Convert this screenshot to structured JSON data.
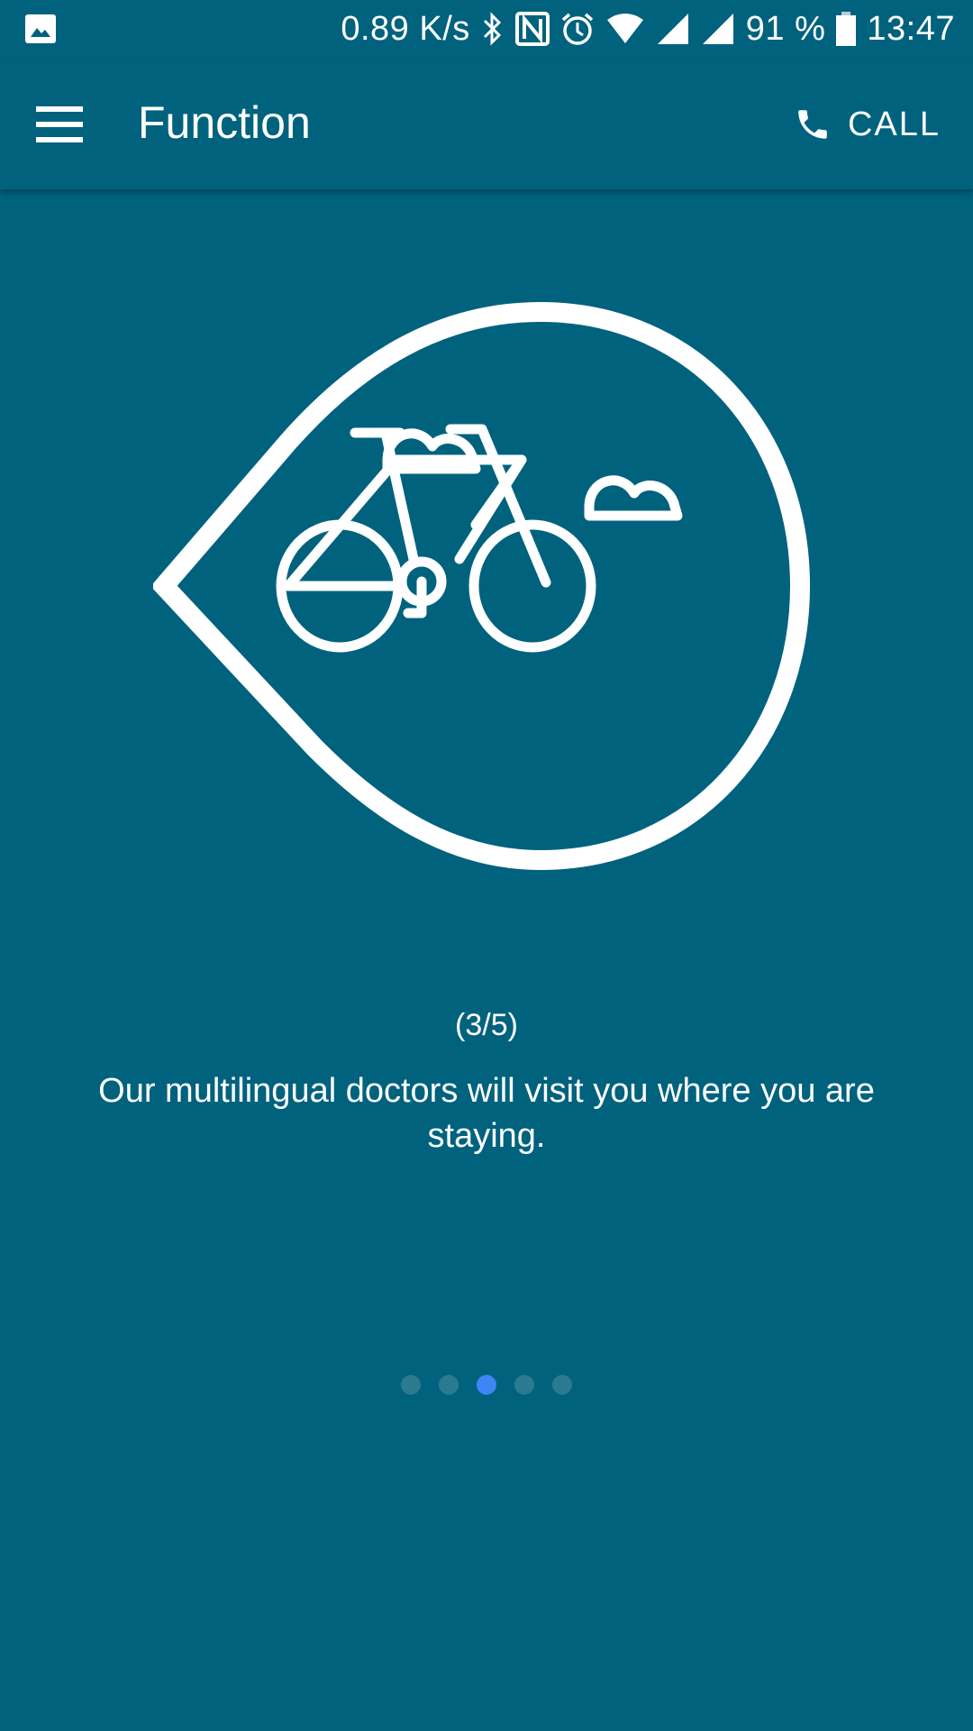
{
  "status_bar": {
    "left_icons": [
      "image-notification-icon"
    ],
    "network_speed": "0.89 K/s",
    "icons": [
      "bluetooth-icon",
      "nfc-icon",
      "alarm-icon",
      "wifi-icon",
      "signal-icon",
      "signal-icon"
    ],
    "battery_percent": "91 %",
    "time": "13:47"
  },
  "app_bar": {
    "menu_icon": "hamburger-menu-icon",
    "title": "Function",
    "call_icon": "phone-icon",
    "call_label": "CALL"
  },
  "slide": {
    "illustration": "bicycle-in-drop-pin-illustration",
    "counter": "(3/5)",
    "description": "Our multilingual doctors will visit you where you are staying."
  },
  "pager": {
    "total": 5,
    "current": 3,
    "active_color": "#3d86f5",
    "inactive_color": "#2c7a8f"
  },
  "colors": {
    "background": "#01627e",
    "foreground": "#ffffff"
  }
}
